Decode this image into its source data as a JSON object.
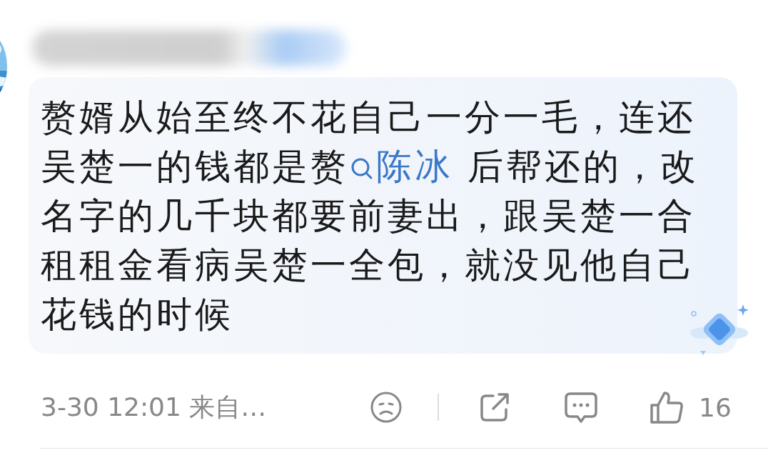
{
  "comment": {
    "text_before": "赘婿从始至终不花自己一分一毛，连还吴楚一的钱都是赘",
    "search_link": "陈冰",
    "text_after": " 后帮还的，改名字的几千块都要前妻出，跟吴楚一合租租金看病吴楚一全包，就没见他自己花钱的时候"
  },
  "footer": {
    "time": "3-30 12:01",
    "source": "来自…",
    "like_count": "16"
  }
}
